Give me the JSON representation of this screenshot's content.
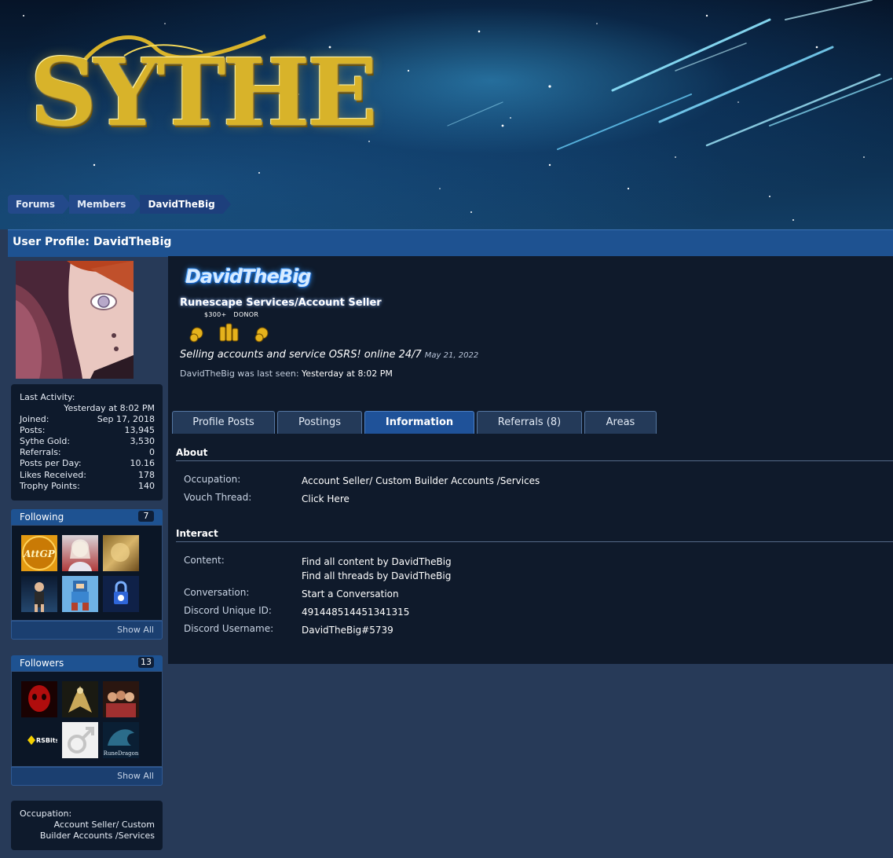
{
  "breadcrumb": [
    "Forums",
    "Members",
    "DavidTheBig"
  ],
  "page_title": "User Profile: DavidTheBig",
  "sidebar": {
    "last_activity_label": "Last Activity:",
    "last_activity_value": "Yesterday at 8:02 PM",
    "stats": [
      {
        "label": "Joined:",
        "value": "Sep 17, 2018"
      },
      {
        "label": "Posts:",
        "value": "13,945"
      },
      {
        "label": "Sythe Gold:",
        "value": "3,530"
      },
      {
        "label": "Referrals:",
        "value": "0"
      },
      {
        "label": "Posts per Day:",
        "value": "10.16"
      },
      {
        "label": "Likes Received:",
        "value": "178"
      },
      {
        "label": "Trophy Points:",
        "value": "140"
      }
    ],
    "following": {
      "title": "Following",
      "count": "7",
      "show_all": "Show All"
    },
    "followers": {
      "title": "Followers",
      "count": "13",
      "show_all": "Show All"
    },
    "occupation_label": "Occupation:",
    "occupation_value": "Account Seller/ Custom Builder Accounts /Services"
  },
  "profile": {
    "username": "DavidTheBig",
    "user_title": "Runescape Services/Account Seller",
    "award_tags": [
      "$300+",
      "DONOR"
    ],
    "status": "Selling accounts and service OSRS! online 24/7",
    "status_date": "May 21, 2022",
    "last_seen_prefix": "DavidTheBig was last seen:",
    "last_seen_value": "Yesterday at 8:02 PM"
  },
  "tabs": [
    "Profile Posts",
    "Postings",
    "Information",
    "Referrals (8)",
    "Areas"
  ],
  "active_tab": "Information",
  "about": {
    "heading": "About",
    "rows": [
      {
        "label": "Occupation:",
        "value": "Account Seller/ Custom Builder Accounts /Services"
      },
      {
        "label": "Vouch Thread:",
        "value": "Click Here"
      }
    ]
  },
  "interact": {
    "heading": "Interact",
    "content_label": "Content:",
    "content_links": [
      "Find all content by DavidTheBig",
      "Find all threads by DavidTheBig"
    ],
    "rows": [
      {
        "label": "Conversation:",
        "value": "Start a Conversation"
      },
      {
        "label": "Discord Unique ID:",
        "value": "491448514451341315"
      },
      {
        "label": "Discord Username:",
        "value": "DavidTheBig#5739"
      }
    ]
  },
  "thumb_text": {
    "following_1": "AttGP",
    "followers_4": "RSBits",
    "followers_6": "RuneDragon"
  }
}
